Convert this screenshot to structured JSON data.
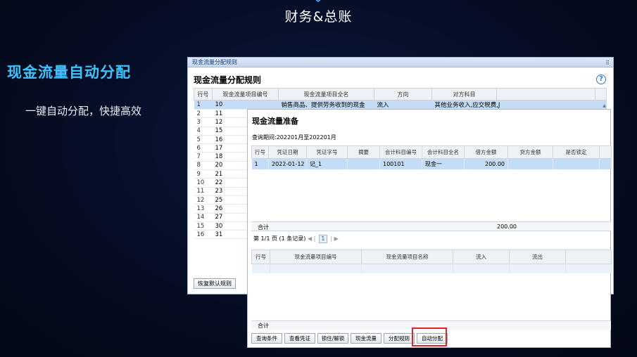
{
  "page": {
    "title": "财务&总账"
  },
  "feature": {
    "title": "现金流量自动分配",
    "description": "一键自动分配，快捷高效"
  },
  "back_window": {
    "window_title": "现金流量分配规则",
    "heading": "现金流量分配规则",
    "columns": [
      "行号",
      "现金流量项目编号",
      "现金流量项目全名",
      "方向",
      "对方科目"
    ],
    "rows": [
      {
        "idx": "1",
        "code": "10",
        "name": "销售商品、提供劳务收到的现金",
        "direction": "流入",
        "account": "其他业务收入,应交税费,J"
      },
      {
        "idx": "2",
        "code": "11"
      },
      {
        "idx": "3",
        "code": "12"
      },
      {
        "idx": "4",
        "code": "15"
      },
      {
        "idx": "5",
        "code": "16"
      },
      {
        "idx": "6",
        "code": "17"
      },
      {
        "idx": "7",
        "code": "18"
      },
      {
        "idx": "8",
        "code": "20"
      },
      {
        "idx": "9",
        "code": "21"
      },
      {
        "idx": "10",
        "code": "22"
      },
      {
        "idx": "11",
        "code": "23"
      },
      {
        "idx": "12",
        "code": "25"
      },
      {
        "idx": "13",
        "code": "26"
      },
      {
        "idx": "14",
        "code": "27"
      },
      {
        "idx": "15",
        "code": "30"
      },
      {
        "idx": "16",
        "code": "31"
      }
    ],
    "restore_button": "恢复默认规则"
  },
  "front_window": {
    "heading": "现金流量准备",
    "period": "查询期间:202201月至202201月",
    "columns": [
      "行号",
      "凭证日期",
      "凭证字号",
      "摘要",
      "会计科目编号",
      "会计科目全名",
      "借方金额",
      "贷方金额",
      "是否锁定"
    ],
    "rows": [
      {
        "idx": "1",
        "date": "2022-01-12",
        "voucher": "记_1",
        "summary": "",
        "acct_code": "100101",
        "acct_name": "现金一",
        "debit": "200.00",
        "credit": "",
        "locked": ""
      }
    ],
    "total_label": "合计",
    "total_debit": "200.00",
    "pager": {
      "prefix": "第 1/1 页 (1 条记录)",
      "current": "1",
      "prev": "◀ |",
      "next": "| ▶"
    },
    "columns2": [
      "行号",
      "现金流量项目编号",
      "现金流量项目名称",
      "流入",
      "流出"
    ],
    "total_label2": "合计",
    "buttons": [
      "查询条件",
      "查看凭证",
      "锁住/解锁",
      "现金流量",
      "分配规则",
      "自动分配"
    ]
  }
}
